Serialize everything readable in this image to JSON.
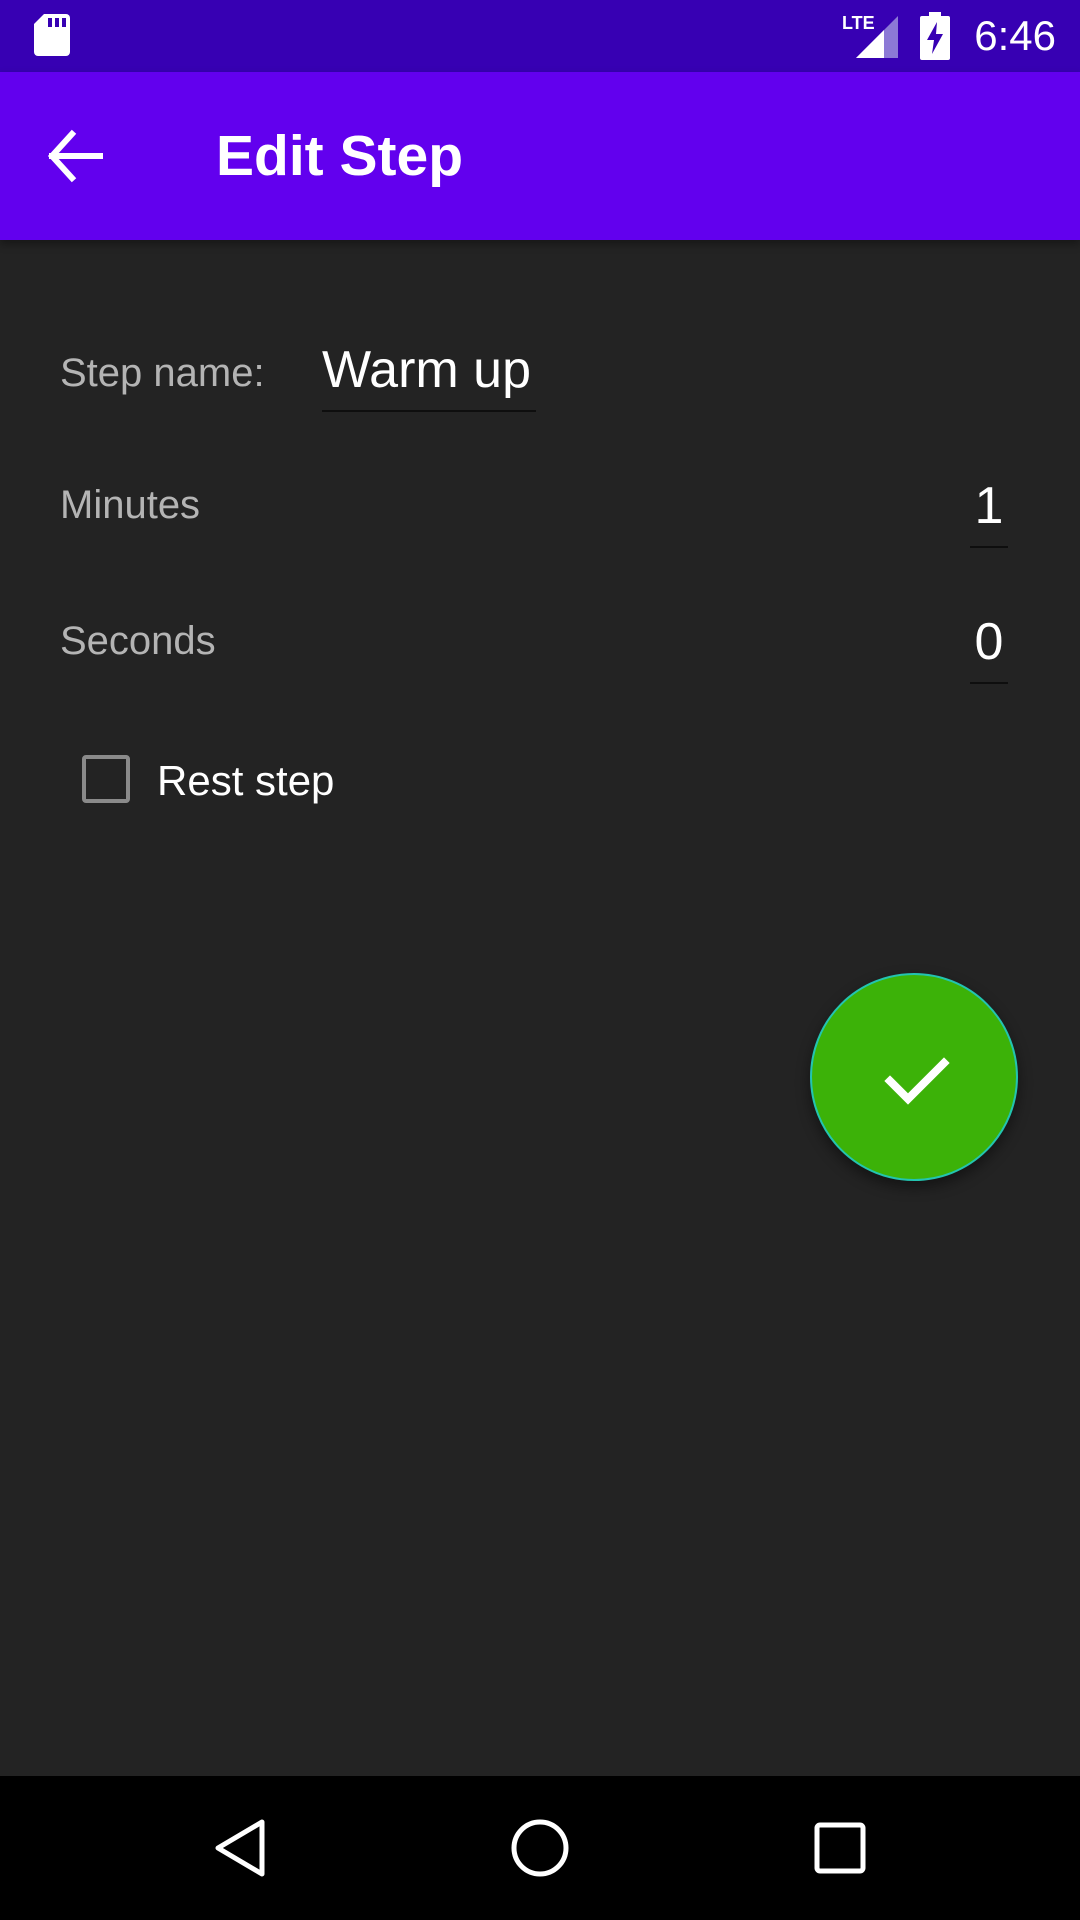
{
  "status_bar": {
    "time": "6:46",
    "network": "LTE"
  },
  "app_bar": {
    "title": "Edit Step"
  },
  "form": {
    "step_name_label": "Step name:",
    "step_name_value": "Warm up",
    "minutes_label": "Minutes",
    "minutes_value": "1",
    "seconds_label": "Seconds",
    "seconds_value": "0",
    "rest_step_label": "Rest step",
    "rest_step_checked": false
  },
  "icons": {
    "back": "arrow-back-icon",
    "fab": "check-icon",
    "nav_back": "triangle-back-icon",
    "nav_home": "circle-home-icon",
    "nav_recents": "square-recents-icon"
  },
  "colors": {
    "status_bar": "#3700b3",
    "app_bar": "#6200ee",
    "background": "#232323",
    "fab": "#3cb208",
    "fab_border": "#23c4b0"
  }
}
